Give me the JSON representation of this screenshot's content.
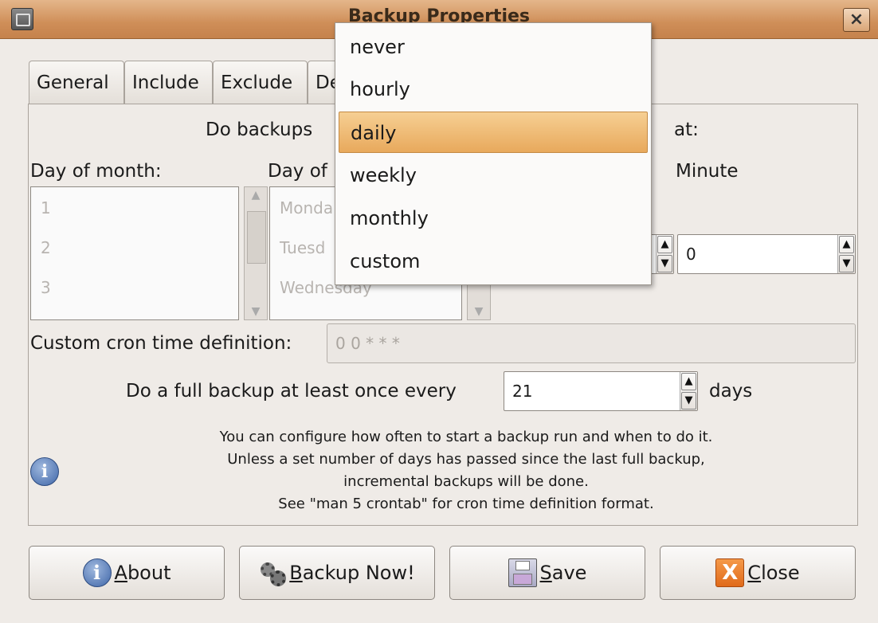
{
  "window": {
    "title": "Backup Properties",
    "close_glyph": "×"
  },
  "tabs": [
    "General",
    "Include",
    "Exclude",
    "De"
  ],
  "schedule": {
    "do_backups_label": "Do backups",
    "at_label": "at:",
    "day_of_month_label": "Day of month:",
    "day_of_week_label": "Day of",
    "minute_label": "Minute",
    "day_of_month_items": [
      "1",
      "2",
      "3"
    ],
    "day_of_week_items": [
      "Monda",
      "Tuesd",
      "Wednesday"
    ],
    "minute_value": "0"
  },
  "cron": {
    "label": "Custom cron time definition:",
    "value": "0 0 * * *"
  },
  "full_backup": {
    "label": "Do a full backup at least once every",
    "value": "21",
    "unit": "days"
  },
  "info": {
    "lines": [
      "You can configure how often to start a backup run and when to do it.",
      "Unless a set number of days has passed since the last full backup,",
      "incremental backups will be done.",
      "See \"man 5 crontab\" for cron time definition format."
    ]
  },
  "buttons": {
    "about": {
      "mnemonic": "A",
      "rest": "bout"
    },
    "backup_now": {
      "mnemonic": "B",
      "rest": "ackup Now!"
    },
    "save": {
      "mnemonic": "S",
      "rest": "ave"
    },
    "close": {
      "mnemonic": "C",
      "rest": "lose"
    }
  },
  "dropdown": {
    "options": [
      "never",
      "hourly",
      "daily",
      "weekly",
      "monthly",
      "custom"
    ],
    "selected": "daily"
  },
  "colors": {
    "titlebar": "#cf8e58",
    "selection": "#e8a95c",
    "background": "#efebe7"
  }
}
